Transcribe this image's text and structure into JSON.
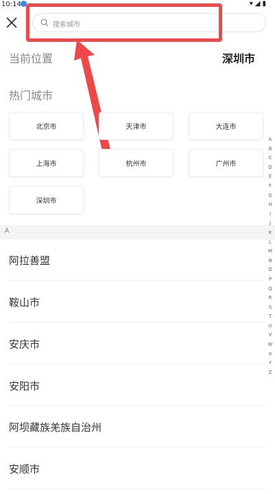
{
  "status_bar": {
    "time": "10:14",
    "icons": "▾◢▮"
  },
  "search": {
    "placeholder": "搜索城市"
  },
  "current_location": {
    "label": "当前位置",
    "city": "深圳市"
  },
  "hot_cities": {
    "title": "热门城市",
    "items": [
      "北京市",
      "天津市",
      "大连市",
      "上海市",
      "杭州市",
      "广州市",
      "深圳市"
    ]
  },
  "section": {
    "letter": "A"
  },
  "city_list": [
    "阿拉善盟",
    "鞍山市",
    "安庆市",
    "安阳市",
    "阿坝藏族羌族自治州",
    "安顺市"
  ],
  "alphabet_index": [
    "A",
    "B",
    "C",
    "D",
    "E",
    "F",
    "G",
    "H",
    "I",
    "J",
    "K",
    "L",
    "M",
    "N",
    "O",
    "P",
    "Q",
    "R",
    "S",
    "T",
    "U",
    "V",
    "W",
    "X",
    "Y",
    "Z"
  ],
  "colors": {
    "annotation": "#f04748",
    "section_bg": "#f4f4f4"
  }
}
